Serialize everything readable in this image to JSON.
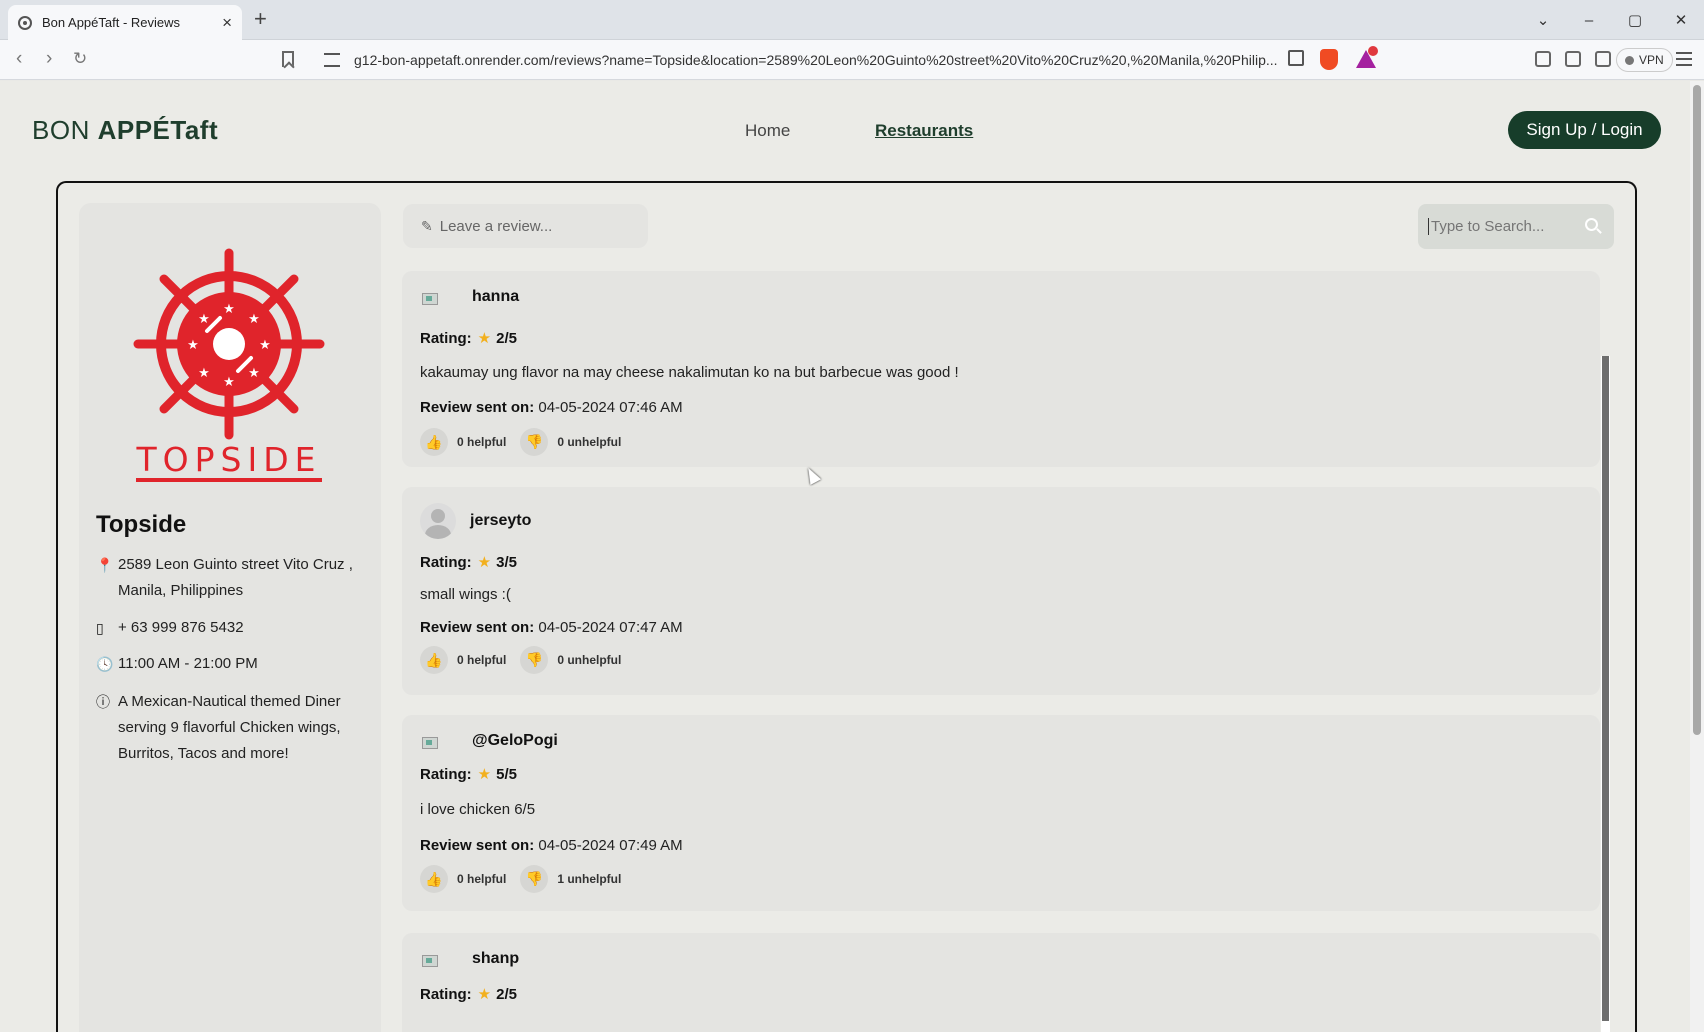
{
  "browser": {
    "tab_title": "Bon AppéTaft - Reviews",
    "url": "g12-bon-appetaft.onrender.com/reviews?name=Topside&location=2589%20Leon%20Guinto%20street%20Vito%20Cruz%20,%20Manila,%20Philip...",
    "vpn_label": "VPN"
  },
  "site": {
    "brand_light": "BON ",
    "brand_bold": "APPÉTaft",
    "nav": {
      "home": "Home",
      "restaurants": "Restaurants"
    },
    "auth_button": "Sign Up / Login"
  },
  "restaurant": {
    "logo_text": "TOPSIDE",
    "name": "Topside",
    "address": "2589 Leon Guinto street Vito Cruz , Manila, Philippines",
    "phone": "+ 63 999 876 5432",
    "hours": "11:00 AM - 21:00 PM",
    "description": "A Mexican-Nautical themed Diner serving 9 flavorful Chicken wings, Burritos, Tacos and more!",
    "brand_color": "#e0242b"
  },
  "reviews_panel": {
    "leave_review_placeholder": "Leave a review...",
    "search_placeholder": "Type to Search...",
    "rating_label": "Rating:",
    "sent_label": "Review sent on:",
    "items": [
      {
        "user": "hanna",
        "avatar": "broken-image",
        "rating": "2/5",
        "text": "kakaumay ung flavor na may cheese nakalimutan ko na but barbecue was good !",
        "sent": "04-05-2024 07:46 AM",
        "helpful": "0 helpful",
        "unhelpful": "0 unhelpful"
      },
      {
        "user": "jerseyto",
        "avatar": "default-user",
        "rating": "3/5",
        "text": "small wings :(",
        "sent": "04-05-2024 07:47 AM",
        "helpful": "0 helpful",
        "unhelpful": "0 unhelpful"
      },
      {
        "user": "@GeloPogi",
        "avatar": "broken-image",
        "rating": "5/5",
        "text": "i love chicken 6/5",
        "sent": "04-05-2024 07:49 AM",
        "helpful": "0 helpful",
        "unhelpful": "1 unhelpful"
      },
      {
        "user": "shanp",
        "avatar": "broken-image",
        "rating": "2/5"
      }
    ]
  },
  "colors": {
    "primary_dark_green": "#173d2a",
    "star": "#f2b01e"
  }
}
